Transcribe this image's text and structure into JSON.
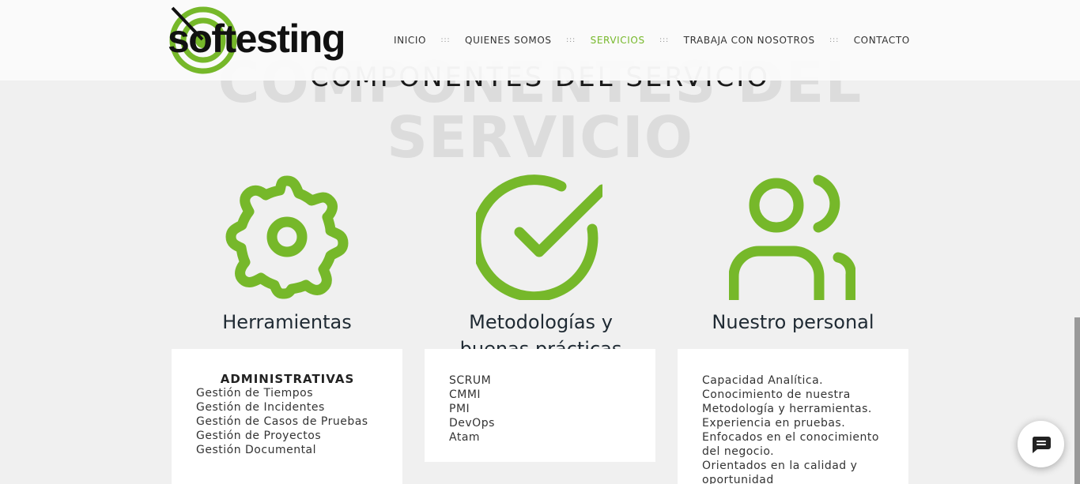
{
  "brand": {
    "name": "softesting",
    "accent": "#76b82a"
  },
  "nav": {
    "items": [
      {
        "label": "INICIO",
        "active": false
      },
      {
        "label": "QUIENES SOMOS",
        "active": false
      },
      {
        "label": "SERVICIOS",
        "active": true
      },
      {
        "label": "TRABAJA CON NOSOTROS",
        "active": false
      },
      {
        "label": "CONTACTO",
        "active": false
      }
    ],
    "separator": ":::"
  },
  "section": {
    "ghost_title_line1": "COMPONENTES DEL",
    "ghost_title_line2": "SERVICIO",
    "title": "COMPONENTES DEL SERVICIO"
  },
  "columns": [
    {
      "title": "Herramientas",
      "icon": "gear-icon",
      "subheading": "ADMINISTRATIVAS",
      "items": [
        "Gestión de Tiempos",
        "Gestión de Incidentes",
        "Gestión de Casos de Pruebas",
        "Gestión de Proyectos",
        "Gestión Documental"
      ]
    },
    {
      "title": "Metodologías y",
      "title_cut": "buenas prácticas",
      "icon": "check-circle-icon",
      "items": [
        "SCRUM",
        "CMMI",
        "PMI",
        "DevOps",
        "Atam"
      ]
    },
    {
      "title": "Nuestro personal",
      "icon": "users-icon",
      "items": [
        "Capacidad Analítica.",
        "Conocimiento de nuestra",
        "Metodología y herramientas.",
        "Experiencia en pruebas.",
        "Enfocados en el conocimiento",
        "del negocio.",
        "Orientados en la calidad y",
        "oportunidad"
      ]
    }
  ],
  "chat": {
    "icon": "chat-icon"
  }
}
